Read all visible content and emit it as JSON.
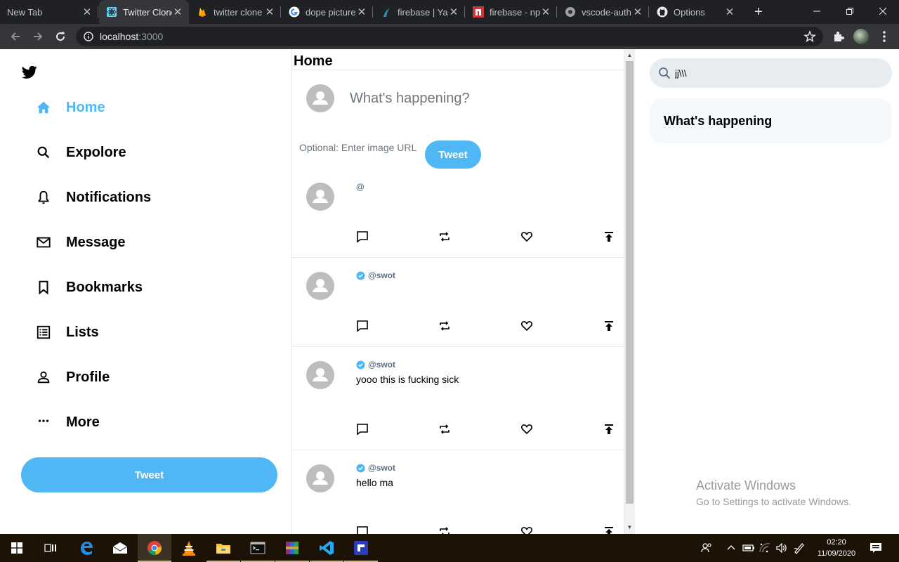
{
  "browser": {
    "tabs": [
      {
        "title": "New Tab",
        "icon": "none",
        "active": false
      },
      {
        "title": "Twitter Clone",
        "icon": "react-icon",
        "active": true
      },
      {
        "title": "twitter clone",
        "icon": "firebase-icon",
        "active": false
      },
      {
        "title": "dope pictures",
        "icon": "google-icon",
        "active": false
      },
      {
        "title": "firebase | Yarn",
        "icon": "yarn-icon",
        "active": false
      },
      {
        "title": "firebase - npm",
        "icon": "npm-icon",
        "active": false
      },
      {
        "title": "vscode-auth",
        "icon": "globe-icon",
        "active": false
      },
      {
        "title": "Options",
        "icon": "github-icon",
        "active": false
      }
    ],
    "url_host": "localhost",
    "url_port": ":3000"
  },
  "sidebar": {
    "items": [
      {
        "label": "Home",
        "icon": "home-icon",
        "active": true
      },
      {
        "label": "Expolore",
        "icon": "search-icon",
        "active": false
      },
      {
        "label": "Notifications",
        "icon": "bell-icon",
        "active": false
      },
      {
        "label": "Message",
        "icon": "mail-icon",
        "active": false
      },
      {
        "label": "Bookmarks",
        "icon": "bookmark-icon",
        "active": false
      },
      {
        "label": "Lists",
        "icon": "list-icon",
        "active": false
      },
      {
        "label": "Profile",
        "icon": "person-icon",
        "active": false
      },
      {
        "label": "More",
        "icon": "more-icon",
        "active": false
      }
    ],
    "tweet_label": "Tweet"
  },
  "feed": {
    "title": "Home",
    "composer_placeholder": "What's happening?",
    "image_placeholder": "Optional: Enter image URL",
    "tweet_label": "Tweet",
    "posts": [
      {
        "handle": "@",
        "verified": false,
        "text": ""
      },
      {
        "handle": "@swot",
        "verified": true,
        "text": ""
      },
      {
        "handle": "@swot",
        "verified": true,
        "text": "yooo this is fucking sick"
      },
      {
        "handle": "@swot",
        "verified": true,
        "text": "hello ma"
      }
    ]
  },
  "widgets": {
    "search_value": "jj\\\\\\",
    "trends_title": "What's happening"
  },
  "watermark": {
    "line1": "Activate Windows",
    "line2": "Go to Settings to activate Windows."
  },
  "taskbar": {
    "time": "02:20",
    "date": "11/09/2020"
  },
  "colors": {
    "accent": "#50b7f5",
    "chrome_bg": "#202124",
    "taskbar_bg": "#1c1206"
  }
}
